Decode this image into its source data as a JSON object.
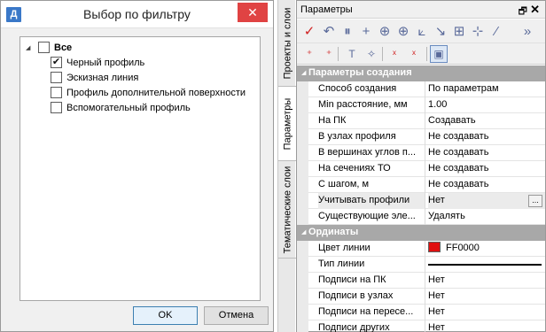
{
  "dialog": {
    "app_icon": "Д",
    "title": "Выбор по фильтру",
    "close_glyph": "✕",
    "tree": {
      "root": {
        "label": "Все",
        "checked": false,
        "expander": "◢"
      },
      "children": [
        {
          "label": "Черный профиль",
          "checked": true
        },
        {
          "label": "Эскизная линия",
          "checked": false
        },
        {
          "label": "Профиль дополнительной поверхности",
          "checked": false
        },
        {
          "label": "Вспомогательный профиль",
          "checked": false
        }
      ]
    },
    "ok_label": "OK",
    "cancel_label": "Отмена"
  },
  "vtabs": [
    {
      "label": "Проекты и слои",
      "active": false
    },
    {
      "label": "Параметры",
      "active": true
    },
    {
      "label": "Тематические слои",
      "active": false
    }
  ],
  "panel": {
    "title": "Параметры",
    "pin_glyph": "🗗",
    "close_glyph": "✕",
    "toolbar1_icons": [
      "checkmark-icon",
      "undo-curve-icon",
      "split-icon",
      "crosshair-plus-icon",
      "target-icon",
      "target-node-icon",
      "object-snap-icon",
      "cursor-snap-icon",
      "grid-snap-icon",
      "node-add-icon",
      "eyedropper-icon",
      "overflow-icon"
    ],
    "toolbar1_glyphs": [
      "✓",
      "↶",
      "⏸",
      "+",
      "⊕",
      "⊕",
      "⟀",
      "↘",
      "⊞",
      "⊹",
      "⁄",
      "»"
    ],
    "toolbar2_icons": [
      "add-point-icon",
      "add-multipoint-icon",
      "text-add-icon",
      "move-point-icon",
      "delete-points-icon",
      "delete-node-icon",
      "properties-toggle-icon"
    ],
    "toolbar2_glyphs": [
      "⁺",
      "⁺",
      "T",
      "✧",
      "ˣ",
      "ˣ",
      "▣"
    ],
    "accent_red": "#d02020",
    "categories": [
      {
        "label": "Параметры создания",
        "rows": [
          {
            "name": "Способ создания",
            "value": "По параметрам"
          },
          {
            "name": "Min расстояние, мм",
            "value": "1.00"
          },
          {
            "name": "На ПК",
            "value": "Создавать"
          },
          {
            "name": "В узлах профиля",
            "value": "Не создавать"
          },
          {
            "name": "В вершинах углов п...",
            "value": "Не создавать"
          },
          {
            "name": "На сечениях ТО",
            "value": "Не создавать"
          },
          {
            "name": "С шагом, м",
            "value": "Не создавать"
          },
          {
            "name": "Учитывать профили",
            "value": "Нет",
            "selected": true,
            "ellipsis": "..."
          },
          {
            "name": "Существующие эле...",
            "value": "Удалять"
          }
        ]
      },
      {
        "label": "Ординаты",
        "rows": [
          {
            "name": "Цвет линии",
            "value": "FF0000",
            "swatch": "#e01010"
          },
          {
            "name": "Тип линии",
            "value": ""
          },
          {
            "name": "Подписи на ПК",
            "value": "Нет"
          },
          {
            "name": "Подписи в узлах",
            "value": "Нет"
          },
          {
            "name": "Подписи на пересе...",
            "value": "Нет"
          },
          {
            "name": "Подписи других",
            "value": "Нет"
          }
        ]
      }
    ]
  }
}
